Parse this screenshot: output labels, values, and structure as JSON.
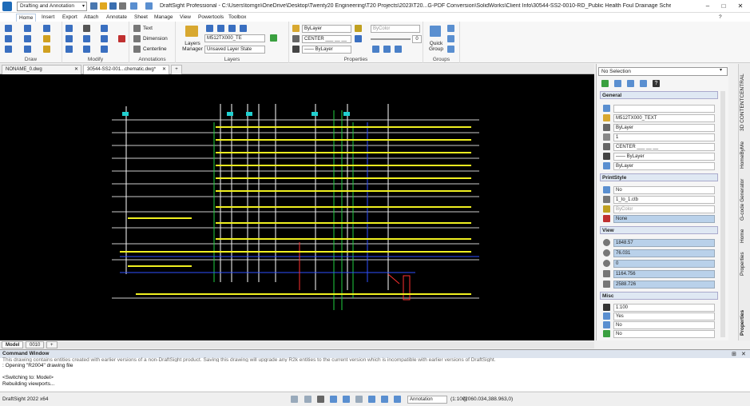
{
  "app": {
    "workspace": "Drafting and Annotation",
    "title": "DraftSight Professional - C:\\Users\\tomgn\\OneDrive\\Desktop\\Twenty20 Engineering\\T20 Projects\\2023\\T20...G-PDF Conversion\\SolidWorks\\Client Info\\30544-SS2-0010-RD_Public Health Foul Drainage Schematic.dwg*"
  },
  "menu_tabs": [
    "Home",
    "Insert",
    "Export",
    "Attach",
    "Annotate",
    "Sheet",
    "Manage",
    "View",
    "Powertools",
    "Toolbox"
  ],
  "ribbon": {
    "groups": [
      "Draw",
      "Modify",
      "Annotations",
      "Layers",
      "Properties",
      "Groups"
    ],
    "annotations": {
      "text": "Text",
      "dimension": "Dimension",
      "centerline": "Centerline"
    },
    "layers": {
      "manager": "Layers Manager",
      "layer_combo": "M512TX000_TE",
      "state_combo": "Unsaved Layer State"
    },
    "properties": {
      "color_combo": "ByLayer",
      "linestyle_combo": "CENTER ___ __ __",
      "lineweight_combo": "—— ByLayer",
      "plot_color": "ByColor",
      "transparency": "0"
    },
    "groups_quick": "Quick Group"
  },
  "doc_tabs": [
    "NONAME_0.dwg",
    "30544-SS2-001...chematic.dwg*"
  ],
  "layout_tabs": [
    "Model",
    "0010",
    "+"
  ],
  "command": {
    "title": "Command Window",
    "lines": [
      "This drawing contains entities created with earlier versions of a non-DraftSight product. Saving this drawing will upgrade any R2k entities to the current version which is incompatible with earlier versions of DraftSight.",
      ": Opening \"R2004\" drawing file",
      "",
      "<Switching to: Model>",
      "Rebuilding viewports..."
    ]
  },
  "status": {
    "version": "DraftSight 2022 x64",
    "annotation": "Annotation",
    "scale": "(1:100)",
    "coords": "(2060.034,388.963,0)"
  },
  "properties": {
    "selection": "No Selection",
    "general_title": "General",
    "general": [
      "",
      "M512TX000_TEXT",
      "ByLayer",
      "1",
      "CENTER ___ __ __",
      "—— ByLayer",
      "ByLayer"
    ],
    "printstyle_title": "PrintStyle",
    "printstyle": [
      "No",
      "1_to_1.ctb",
      "ByColor",
      "None"
    ],
    "view_title": "View",
    "view": [
      "1848.57",
      "76.031",
      "0",
      "1164.756",
      "2588.726"
    ],
    "misc_title": "Misc",
    "misc": [
      "1:100",
      "Yes",
      "No",
      "No"
    ]
  },
  "side_tabs": [
    "3D CONTENTCENTRAL",
    "HomeByMe",
    "G-code Generator",
    "Home",
    "Properties"
  ],
  "colors": {
    "accent": "#1e6bb8",
    "canvas": "#000000",
    "highlight": "#b9d1ea"
  }
}
